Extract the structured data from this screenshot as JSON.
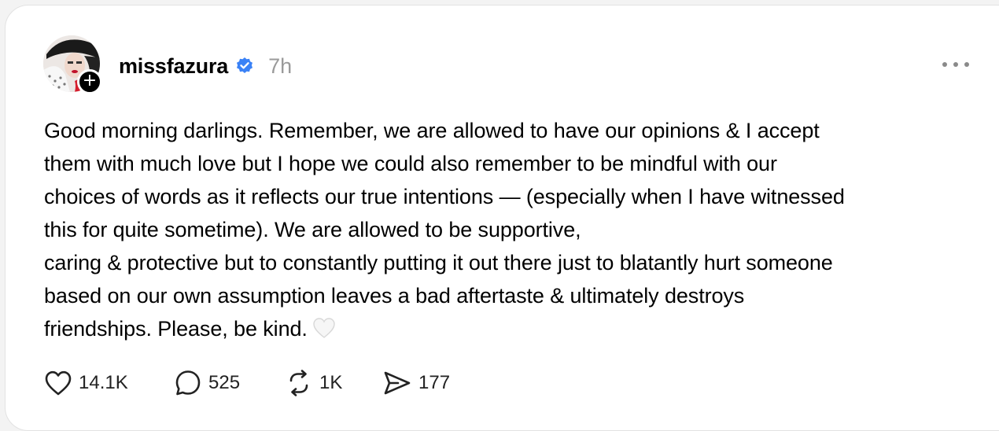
{
  "post": {
    "username": "missfazura",
    "timestamp": "7h",
    "lines": [
      "Good morning darlings. Remember, we are allowed to have our opinions & I accept",
      "them with much love but I hope we could also remember to be mindful with our",
      "choices of words as it reflects our true intentions — (especially when I have witnessed",
      "this for quite sometime). We are allowed to be supportive,",
      "caring & protective but to constantly putting it out there just to blatantly hurt someone",
      "based on our own assumption leaves a bad aftertaste & ultimately destroys",
      "friendships. Please, be kind."
    ],
    "emoji": "white-heart"
  },
  "actions": {
    "likes": "14.1K",
    "replies": "525",
    "reposts": "1K",
    "shares": "177"
  },
  "icons": {
    "verified": "verified-badge-icon",
    "follow": "plus-icon",
    "more": "ellipsis-icon",
    "like": "heart-icon",
    "reply": "comment-icon",
    "repost": "repost-icon",
    "share": "send-icon"
  },
  "colors": {
    "verified_blue": "#3b82f6",
    "timestamp_gray": "#9a9a9a",
    "text": "#000000",
    "background": "#f3f3f3"
  }
}
